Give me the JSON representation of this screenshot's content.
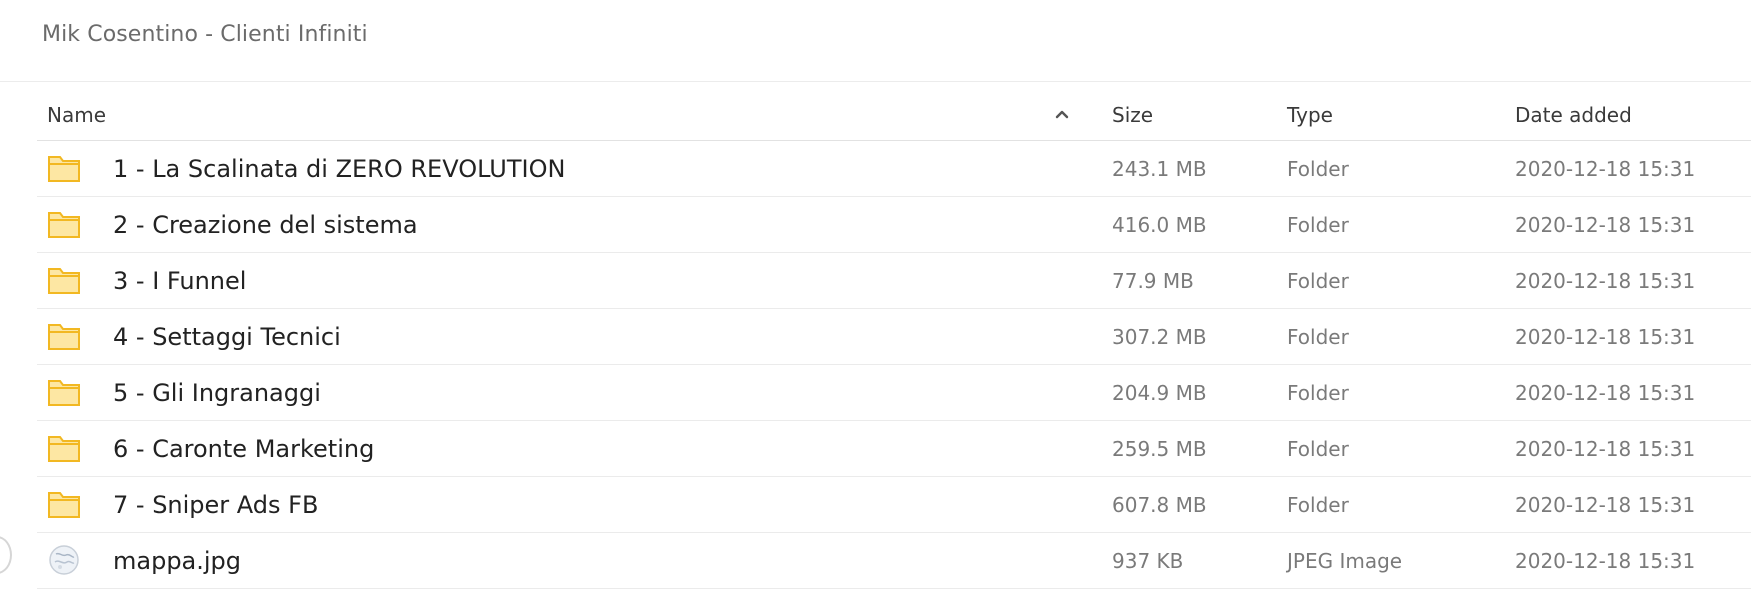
{
  "breadcrumb": "Mik Cosentino - Clienti Infiniti",
  "columns": {
    "name": "Name",
    "size": "Size",
    "type": "Type",
    "date": "Date added"
  },
  "sort": {
    "column": "Name",
    "direction": "ascending",
    "icon": "chevron-up-icon"
  },
  "colors": {
    "folder_fill": "#fde7a3",
    "folder_stroke": "#f2b822",
    "text_primary": "#222222",
    "text_secondary": "#7a7a7a"
  },
  "files": [
    {
      "name": "1 - La Scalinata di ZERO REVOLUTION",
      "size": "243.1 MB",
      "type": "Folder",
      "date": "2020-12-18 15:31",
      "icon": "folder-icon"
    },
    {
      "name": "2 - Creazione del sistema",
      "size": "416.0 MB",
      "type": "Folder",
      "date": "2020-12-18 15:31",
      "icon": "folder-icon"
    },
    {
      "name": "3 - I Funnel",
      "size": "77.9 MB",
      "type": "Folder",
      "date": "2020-12-18 15:31",
      "icon": "folder-icon"
    },
    {
      "name": "4 - Settaggi Tecnici",
      "size": "307.2 MB",
      "type": "Folder",
      "date": "2020-12-18 15:31",
      "icon": "folder-icon"
    },
    {
      "name": "5 - Gli Ingranaggi",
      "size": "204.9 MB",
      "type": "Folder",
      "date": "2020-12-18 15:31",
      "icon": "folder-icon"
    },
    {
      "name": "6 - Caronte Marketing",
      "size": "259.5 MB",
      "type": "Folder",
      "date": "2020-12-18 15:31",
      "icon": "folder-icon"
    },
    {
      "name": "7 - Sniper Ads FB",
      "size": "607.8 MB",
      "type": "Folder",
      "date": "2020-12-18 15:31",
      "icon": "folder-icon"
    },
    {
      "name": "mappa.jpg",
      "size": "937 KB",
      "type": "JPEG Image",
      "date": "2020-12-18 15:31",
      "icon": "image-thumbnail-icon"
    }
  ]
}
